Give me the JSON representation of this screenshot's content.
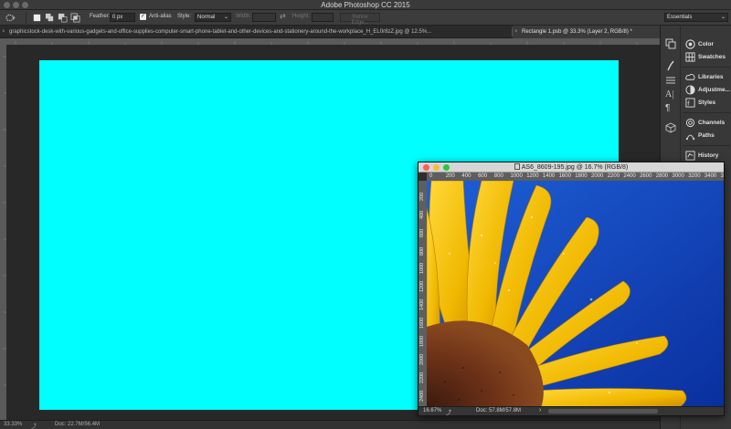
{
  "app": {
    "title": "Adobe Photoshop CC 2015"
  },
  "options_bar": {
    "feather_label": "Feather:",
    "feather_value": "0 px",
    "anti_alias_label": "Anti-alias",
    "style_label": "Style:",
    "style_value": "Normal",
    "width_label": "Width:",
    "height_label": "Height:",
    "refine_edge_label": "Refine Edge...",
    "workspace_value": "Essentials"
  },
  "tabs": [
    {
      "label": "graphicstock-desk-with-various-gadgets-and-office-supplies-computer-smart-phone-tablet-and-other-devices-and-stationery-around-the-workplace_H_EL0r8zZ.jpg @ 12.5%..."
    },
    {
      "label": "Rectangle 1.psb @ 33.3% (Layer 2, RGB/8) *"
    }
  ],
  "status_bar": {
    "zoom": "33.33%",
    "doc": "Doc: 22.7M/56.4M"
  },
  "panel": {
    "items": [
      {
        "label": "Color",
        "icon": "color-wheel-icon"
      },
      {
        "label": "Swatches",
        "icon": "swatches-grid-icon"
      },
      {
        "label": "Libraries",
        "icon": "libraries-cloud-icon"
      },
      {
        "label": "Adjustme...",
        "icon": "adjustments-icon"
      },
      {
        "label": "Styles",
        "icon": "styles-fx-icon"
      },
      {
        "label": "Channels",
        "icon": "channels-icon"
      },
      {
        "label": "Paths",
        "icon": "paths-pen-icon"
      },
      {
        "label": "History",
        "icon": "history-icon"
      }
    ]
  },
  "floating_window": {
    "title": "AS6_8609-195.jpg @ 16.7% (RGB/8)",
    "ruler_labels": [
      "0",
      "200",
      "400",
      "600",
      "800",
      "1000",
      "1200",
      "1400",
      "1600",
      "1800",
      "2000",
      "2200",
      "2400",
      "2600",
      "2800",
      "3000",
      "3200",
      "3400",
      "3600"
    ],
    "vruler_labels": [
      "200",
      "400",
      "600",
      "800",
      "1000",
      "1200",
      "1400",
      "1600",
      "1800",
      "2000",
      "2200",
      "2400"
    ],
    "status_zoom": "16.67%",
    "status_doc": "Doc: 57.8M/57.8M"
  },
  "colors": {
    "canvas_fill": "#00ffff",
    "sky_blue": "#0a3bb8",
    "petal_yellow": "#f2c200"
  }
}
